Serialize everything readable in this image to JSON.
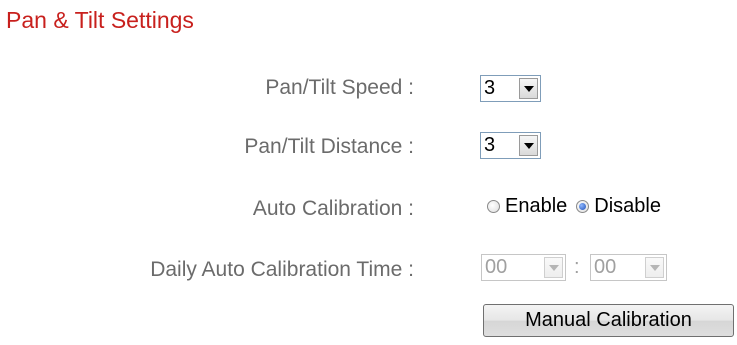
{
  "page": {
    "title": "Pan & Tilt Settings"
  },
  "fields": {
    "speed": {
      "label": "Pan/Tilt Speed :",
      "value": "3"
    },
    "distance": {
      "label": "Pan/Tilt Distance :",
      "value": "3"
    },
    "auto_calibration": {
      "label": "Auto Calibration :",
      "options": [
        "Enable",
        "Disable"
      ],
      "selected": "Disable"
    },
    "daily_time": {
      "label": "Daily Auto Calibration Time :",
      "hour": "00",
      "separator": ":",
      "minute": "00",
      "disabled": true
    }
  },
  "actions": {
    "manual_calibration": "Manual Calibration"
  },
  "colors": {
    "title": "#c8201d",
    "label": "#6b6b6b",
    "select_border": "#7f9db9",
    "radio_checked": "#1f4fb5"
  }
}
